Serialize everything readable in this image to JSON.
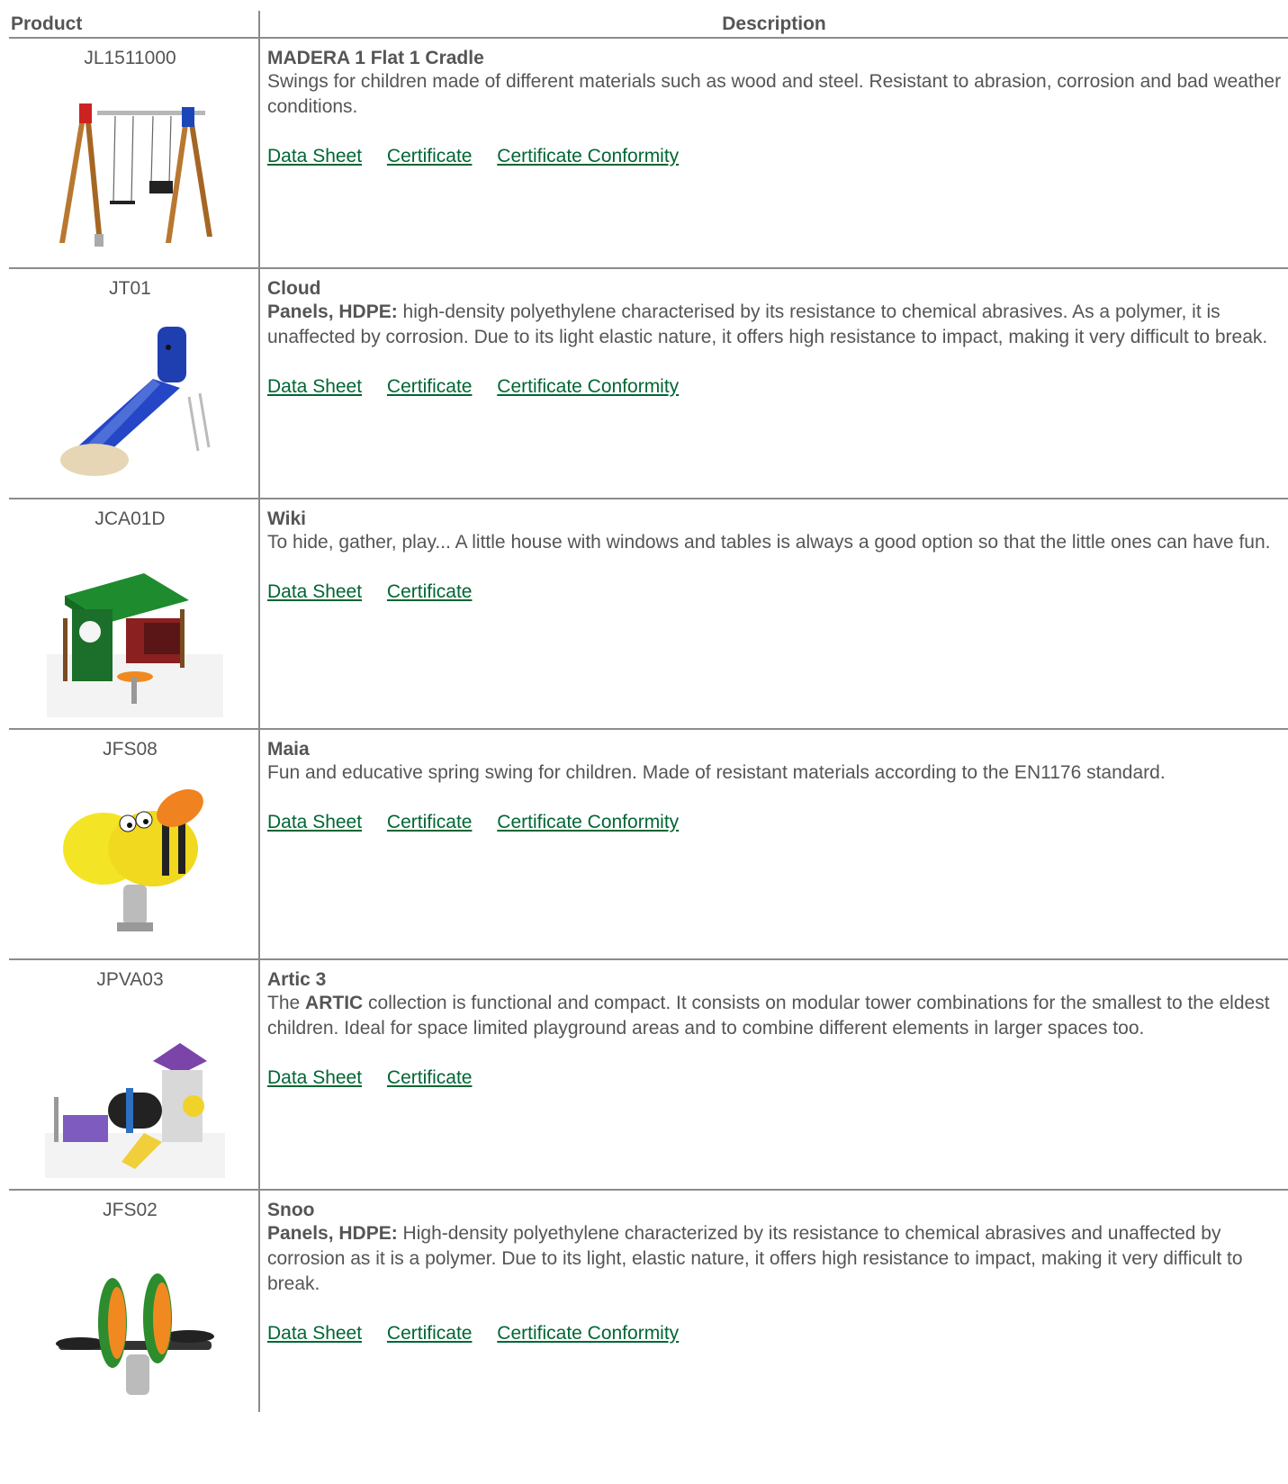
{
  "header": {
    "product": "Product",
    "description": "Description"
  },
  "rows": [
    {
      "code": "JL1511000",
      "title": "MADERA 1 Flat 1 Cradle",
      "lead": "",
      "text": "Swings for children made of different materials such as wood and steel. Resistant to abrasion, corrosion and bad weather conditions.",
      "links": [
        "Data Sheet",
        "Certificate",
        "Certificate Conformity"
      ]
    },
    {
      "code": "JT01",
      "title": "Cloud",
      "lead": "Panels, HDPE:",
      "text": " high-density polyethylene characterised by its resistance to chemical abrasives. As a polymer, it is unaffected by corrosion. Due to its light elastic nature, it offers high resistance to impact, making it very difficult to break.",
      "links": [
        "Data Sheet",
        "Certificate",
        "Certificate Conformity"
      ]
    },
    {
      "code": "JCA01D",
      "title": "Wiki",
      "lead": "",
      "text": "To hide, gather, play... A little house with windows and tables is always a good option so that the little ones can have fun.",
      "links": [
        "Data Sheet",
        "Certificate"
      ]
    },
    {
      "code": "JFS08",
      "title": "Maia",
      "lead": "",
      "text": "Fun and educative spring swing for children. Made of resistant materials according to the EN1176 standard.",
      "links": [
        "Data Sheet",
        "Certificate",
        "Certificate Conformity"
      ]
    },
    {
      "code": "JPVA03",
      "title": "Artic 3",
      "lead_plain": "The ",
      "lead_bold": "ARTIC",
      "text": " collection is functional and compact. It consists on modular tower combinations for the smallest to the eldest children. Ideal for space limited playground areas and to combine different elements in larger spaces too.",
      "links": [
        "Data Sheet",
        "Certificate"
      ]
    },
    {
      "code": "JFS02",
      "title": "Snoo",
      "lead": "Panels, HDPE:",
      "text": " High-density polyethylene characterized by its resistance to chemical abrasives and unaffected by corrosion as it is a polymer. Due to its light, elastic nature, it offers high resistance to impact, making it very difficult to break.",
      "links": [
        "Data Sheet",
        "Certificate",
        "Certificate Conformity"
      ]
    }
  ],
  "icons": [
    "swing-set-image",
    "slide-image",
    "playhouse-image",
    "bee-spring-rider-image",
    "tower-playground-image",
    "spring-seesaw-image"
  ]
}
